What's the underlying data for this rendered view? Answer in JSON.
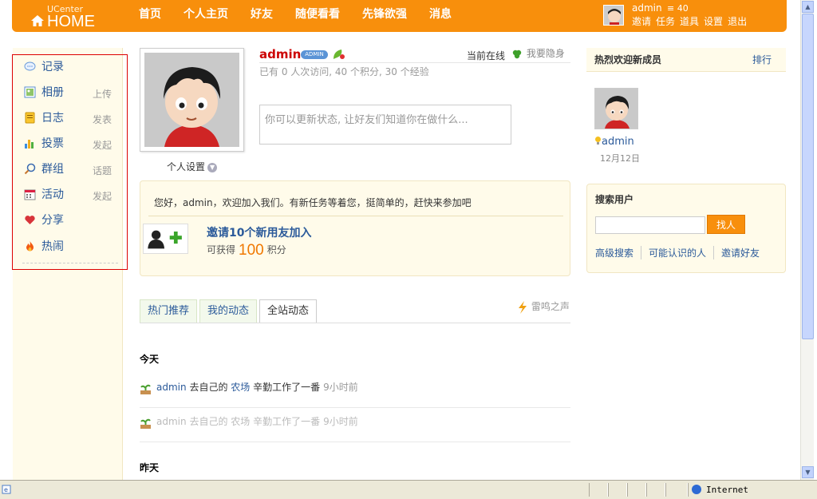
{
  "header": {
    "logo_small": "UCenter",
    "logo_big": "HOME",
    "nav": [
      "首页",
      "个人主页",
      "好友",
      "随便看看",
      "先锋欲强",
      "消息"
    ],
    "user": "admin",
    "credits": "40",
    "links": [
      "邀请",
      "任务",
      "道具",
      "设置",
      "退出"
    ]
  },
  "apps": [
    {
      "label": "记录",
      "action": "",
      "icon": "comment-icon"
    },
    {
      "label": "相册",
      "action": "上传",
      "icon": "photo-icon"
    },
    {
      "label": "日志",
      "action": "发表",
      "icon": "notebook-icon"
    },
    {
      "label": "投票",
      "action": "发起",
      "icon": "bar-chart-icon"
    },
    {
      "label": "群组",
      "action": "话题",
      "icon": "group-icon"
    },
    {
      "label": "活动",
      "action": "发起",
      "icon": "calendar-icon"
    },
    {
      "label": "分享",
      "action": "",
      "icon": "heart-icon"
    },
    {
      "label": "热闹",
      "action": "",
      "icon": "fire-icon"
    }
  ],
  "profile": {
    "name": "admin",
    "badge": "ADMIN",
    "settings": "个人设置",
    "online": "当前在线",
    "hide": "我要隐身",
    "stats": "已有  0 人次访问, 40 个积分, 30 个经验",
    "status_placeholder": "你可以更新状态, 让好友们知道你在做什么..."
  },
  "welcome": {
    "message": "您好，admin，欢迎加入我们。有新任务等着您，挺简单的，赶快来参加吧",
    "task_title": "邀请10个新用友加入",
    "reward_prefix": "可获得",
    "reward_value": "100",
    "reward_unit": "积分"
  },
  "tabs": [
    "热门推荐",
    "我的动态",
    "全站动态"
  ],
  "thunder": "雷鸣之声",
  "feed": {
    "today": "今天",
    "yesterday": "昨天",
    "items": [
      {
        "actor": "admin",
        "pre": "去自己的",
        "app": "农场",
        "post": "辛勤工作了一番",
        "time": "9小时前"
      },
      {
        "actor": "admin",
        "pre": "去自己的",
        "app": "农场",
        "post": "辛勤工作了一番",
        "time": "9小时前"
      }
    ]
  },
  "right": {
    "new_members_title": "热烈欢迎新成员",
    "rank": "排行",
    "member_name": "admin",
    "member_date": "12月12日",
    "search_title": "搜索用户",
    "search_button": "找人",
    "search_links": [
      "高级搜索",
      "可能认识的人",
      "邀请好友"
    ]
  },
  "statusbar": {
    "zone": "Internet"
  },
  "colors": {
    "brand": "#f88f0c",
    "link": "#2b5a9a",
    "panel": "#fffbea"
  }
}
